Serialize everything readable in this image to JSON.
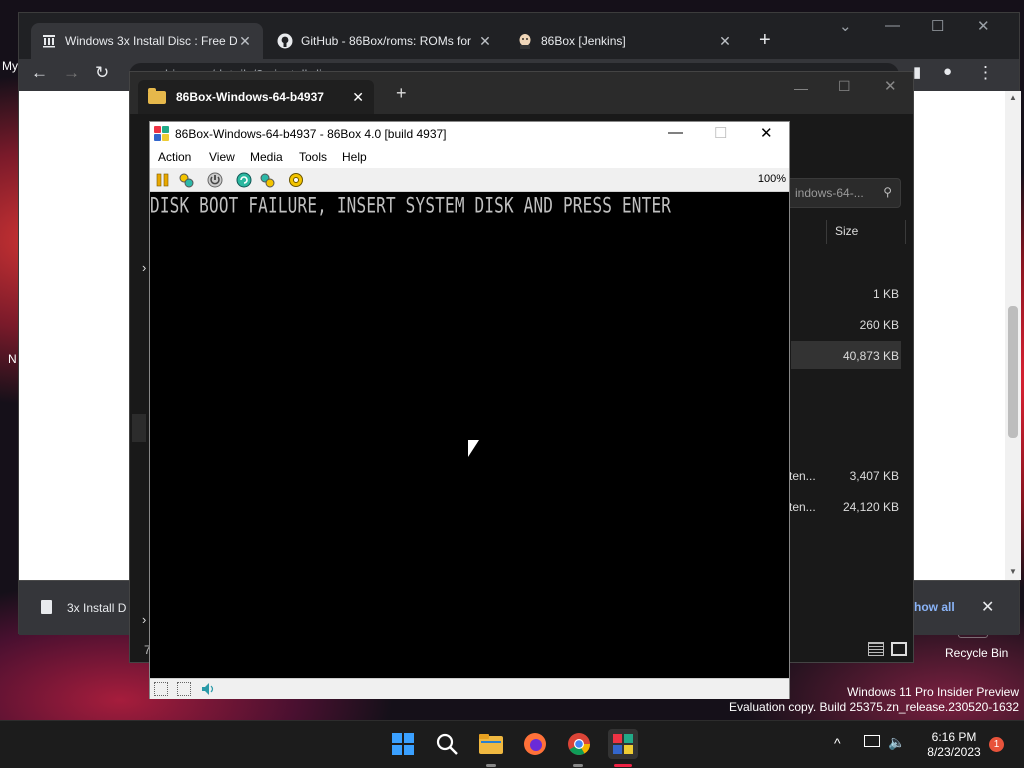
{
  "desktop": {
    "left_labels": [
      "My",
      "N"
    ],
    "recycle_bin": "Recycle Bin",
    "watermark_line1": "Windows 11 Pro Insider Preview",
    "watermark_line2": "Evaluation copy. Build 25375.zn_release.230520-1632"
  },
  "browser": {
    "tabs": [
      {
        "label": "Windows 3x Install Disc : Free Do",
        "icon": "archive-icon"
      },
      {
        "label": "GitHub - 86Box/roms: ROMs for",
        "icon": "github-icon"
      },
      {
        "label": "86Box [Jenkins]",
        "icon": "jenkins-icon"
      }
    ],
    "new_tab": "+",
    "address": "archive.org/details/3x-install-disc",
    "download": {
      "filename": "3x Install D",
      "show_all": "how all"
    }
  },
  "explorer": {
    "tab_title": "86Box-Windows-64-b4937",
    "search_placeholder": "indows-64-...",
    "size_header": "Size",
    "rows": [
      {
        "name": "",
        "size": "1 KB"
      },
      {
        "name": "",
        "size": "260 KB"
      },
      {
        "name": "",
        "size": "40,873 KB"
      },
      {
        "name": "ten...",
        "size": "3,407 KB"
      },
      {
        "name": "ten...",
        "size": "24,120 KB"
      }
    ],
    "status_left": "7"
  },
  "emulator": {
    "title": "86Box-Windows-64-b4937 - 86Box 4.0 [build 4937]",
    "menu": [
      "Action",
      "View",
      "Media",
      "Tools",
      "Help"
    ],
    "zoom": "100%",
    "screen_text": "DISK BOOT FAILURE, INSERT SYSTEM DISK AND PRESS ENTER"
  },
  "taskbar": {
    "time": "6:16 PM",
    "date": "8/23/2023",
    "notification_count": "1"
  },
  "colors": {
    "accent_blue": "#0078d4",
    "notif_badge": "#e8533b",
    "folder_yellow": "#e6b84b"
  }
}
